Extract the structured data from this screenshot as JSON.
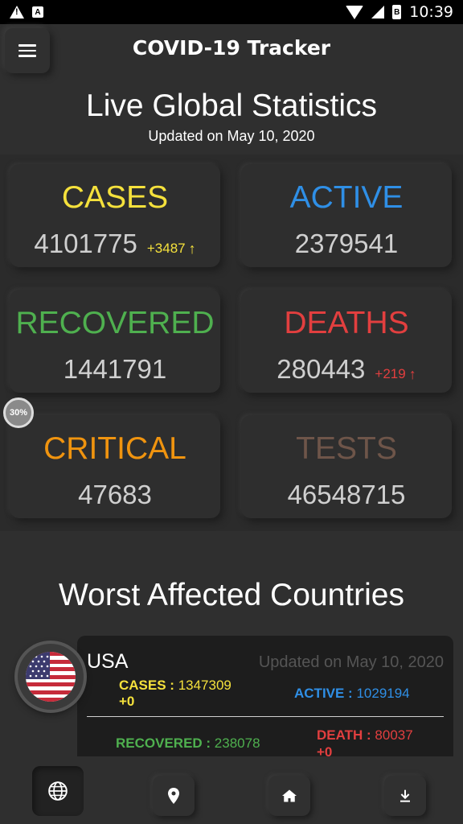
{
  "status_bar": {
    "time": "10:39",
    "battery_glyph": "B"
  },
  "header": {
    "title": "COVID-19 Tracker"
  },
  "global": {
    "title": "Live Global Statistics",
    "updated": "Updated on May 10, 2020",
    "cards": {
      "cases": {
        "label": "CASES",
        "value": "4101775",
        "delta": "+3487",
        "color": "#f5e13c"
      },
      "active": {
        "label": "ACTIVE",
        "value": "2379541",
        "color": "#2f8fe6"
      },
      "recovered": {
        "label": "RECOVERED",
        "value": "1441791",
        "color": "#4fb04f"
      },
      "deaths": {
        "label": "DEATHS",
        "value": "280443",
        "delta": "+219",
        "color": "#e23f3f"
      },
      "critical": {
        "label": "CRITICAL",
        "value": "47683",
        "color": "#f0940f"
      },
      "tests": {
        "label": "TESTS",
        "value": "46548715",
        "color": "#6e5549"
      }
    }
  },
  "progress": {
    "label": "30%",
    "value": 0.3
  },
  "countries": {
    "title": "Worst Affected Countries",
    "items": [
      {
        "name": "USA",
        "updated": "Updated on May 10, 2020",
        "cases_label": "CASES : ",
        "cases": "1347309",
        "cases_delta": "+0",
        "active_label": "ACTIVE : ",
        "active": "1029194",
        "recovered_label": "RECOVERED : ",
        "recovered": "238078",
        "death_label": "DEATH : ",
        "death": "80037",
        "death_delta": "+0",
        "flag_icon": "usa-flag-icon"
      }
    ]
  },
  "bottom_nav": {
    "items": [
      {
        "icon": "globe-icon",
        "active": true
      },
      {
        "icon": "location-pin-icon",
        "active": false
      },
      {
        "icon": "home-icon",
        "active": false
      },
      {
        "icon": "download-icon",
        "active": false
      }
    ]
  }
}
